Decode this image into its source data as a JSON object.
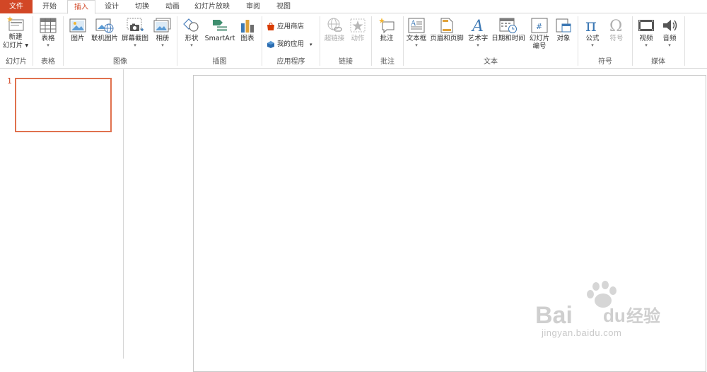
{
  "tabs": [
    {
      "label": "文件"
    },
    {
      "label": "开始"
    },
    {
      "label": "插入"
    },
    {
      "label": "设计"
    },
    {
      "label": "切换"
    },
    {
      "label": "动画"
    },
    {
      "label": "幻灯片放映"
    },
    {
      "label": "审阅"
    },
    {
      "label": "视图"
    }
  ],
  "active_tab": "插入",
  "colors": {
    "accent": "#d24726",
    "thumb_border": "#e0714e"
  },
  "groups": {
    "slides": {
      "label": "幻灯片",
      "new_slide": "新建",
      "new_slide_2": "幻灯片"
    },
    "tables": {
      "label": "表格",
      "table": "表格"
    },
    "images": {
      "label": "图像",
      "picture": "图片",
      "online_picture": "联机图片",
      "screenshot": "屏幕截图",
      "album": "相册"
    },
    "illustrations": {
      "label": "插图",
      "shapes": "形状",
      "smartart": "SmartArt",
      "chart": "图表"
    },
    "apps": {
      "label": "应用程序",
      "store": "应用商店",
      "my_apps": "我的应用"
    },
    "links": {
      "label": "链接",
      "hyperlink": "超链接",
      "action": "动作"
    },
    "comments": {
      "label": "批注",
      "comment": "批注"
    },
    "text": {
      "label": "文本",
      "textbox": "文本框",
      "header_footer": "页眉和页脚",
      "wordart": "艺术字",
      "datetime": "日期和时间",
      "slide_number": "幻灯片",
      "slide_number_2": "编号",
      "object": "对象"
    },
    "symbols": {
      "label": "符号",
      "equation": "公式",
      "symbol": "符号"
    },
    "media": {
      "label": "媒体",
      "video": "视频",
      "audio": "音频"
    }
  },
  "thumbnails": {
    "slide_number": "1"
  },
  "watermark": {
    "brand": "Bai",
    "brand_cn": "经验",
    "url": "jingyan.baidu.com"
  }
}
